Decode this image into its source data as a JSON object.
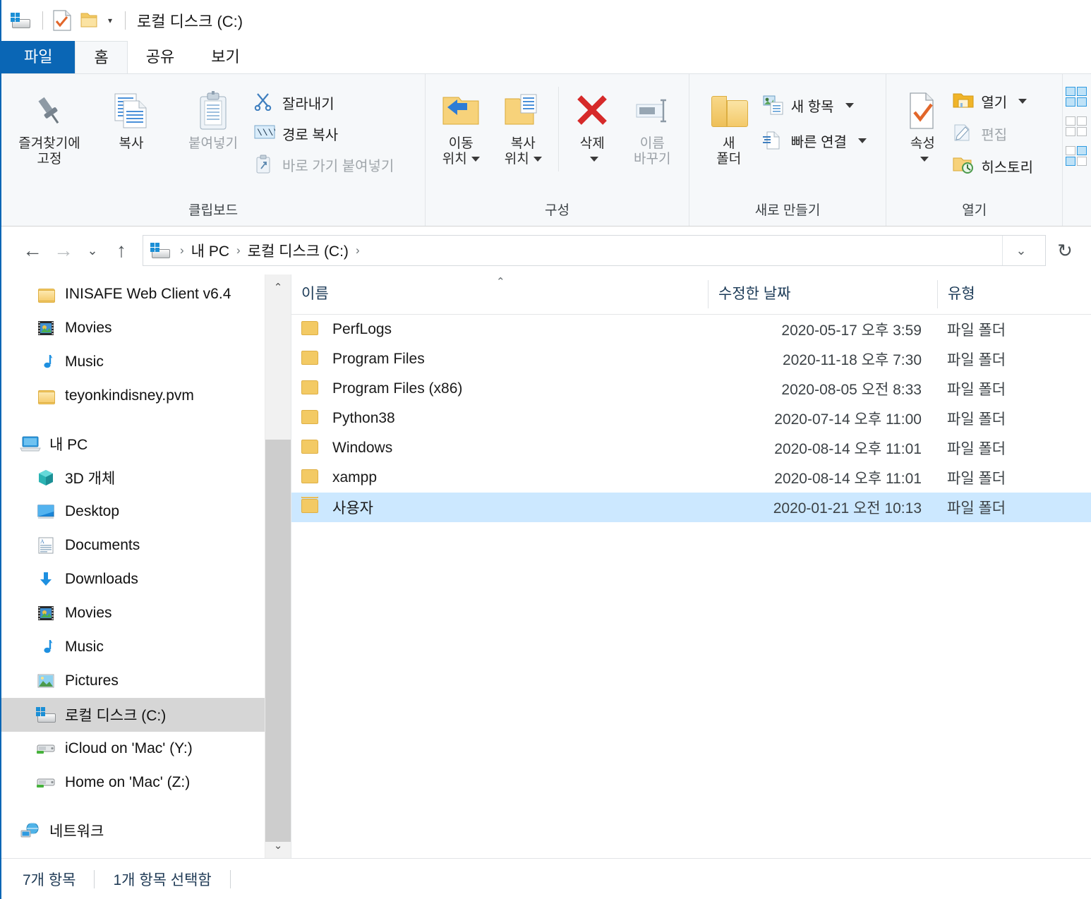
{
  "window": {
    "title": "로컬 디스크 (C:)"
  },
  "quick_access": {
    "icons": [
      "drive-icon",
      "properties-icon",
      "new-folder-icon"
    ],
    "customize_caret": "▾"
  },
  "tabs": [
    {
      "label": "파일",
      "name": "tab-file",
      "active": false,
      "style": "file"
    },
    {
      "label": "홈",
      "name": "tab-home",
      "active": true,
      "style": "normal"
    },
    {
      "label": "공유",
      "name": "tab-share",
      "active": false,
      "style": "normal"
    },
    {
      "label": "보기",
      "name": "tab-view",
      "active": false,
      "style": "normal"
    }
  ],
  "ribbon": {
    "groups": [
      {
        "label": "클립보드",
        "name": "ribbon-group-clipboard",
        "big": [
          {
            "label": "즐겨찾기에\n고정",
            "name": "pin-to-quick-access-button",
            "icon": "pin-icon"
          },
          {
            "label": "복사",
            "name": "copy-button",
            "icon": "copy-icon"
          },
          {
            "label": "붙여넣기",
            "name": "paste-button",
            "icon": "paste-icon",
            "dim": true
          }
        ],
        "small": [
          {
            "label": "잘라내기",
            "name": "cut-button",
            "icon": "scissors-icon",
            "dim": false
          },
          {
            "label": "경로 복사",
            "name": "copy-path-button",
            "icon": "copy-path-icon",
            "dim": false
          },
          {
            "label": "바로 가기 붙여넣기",
            "name": "paste-shortcut-button",
            "icon": "paste-shortcut-icon",
            "dim": true
          }
        ]
      },
      {
        "label": "구성",
        "name": "ribbon-group-organize",
        "big": [
          {
            "label": "이동\n위치",
            "name": "move-to-button",
            "icon": "move-to-icon",
            "caret": true
          },
          {
            "label": "복사\n위치",
            "name": "copy-to-button",
            "icon": "copy-to-icon",
            "caret": true
          },
          {
            "label": "삭제",
            "name": "delete-button",
            "icon": "delete-icon",
            "caret": true
          },
          {
            "label": "이름\n바꾸기",
            "name": "rename-button",
            "icon": "rename-icon",
            "dim": true
          }
        ]
      },
      {
        "label": "새로 만들기",
        "name": "ribbon-group-new",
        "big": [
          {
            "label": "새\n폴더",
            "name": "new-folder-button",
            "icon": "new-folder-icon"
          }
        ],
        "small": [
          {
            "label": "새 항목",
            "name": "new-item-button",
            "icon": "new-item-icon",
            "caret": true
          },
          {
            "label": "빠른 연결",
            "name": "easy-access-button",
            "icon": "easy-access-icon",
            "caret": true
          }
        ]
      },
      {
        "label": "열기",
        "name": "ribbon-group-open",
        "big": [
          {
            "label": "속성",
            "name": "properties-button",
            "icon": "properties-icon",
            "caret": true
          }
        ],
        "small": [
          {
            "label": "열기",
            "name": "open-button",
            "icon": "open-folder-icon",
            "caret": true,
            "dim": false
          },
          {
            "label": "편집",
            "name": "edit-button",
            "icon": "edit-icon",
            "dim": true
          },
          {
            "label": "히스토리",
            "name": "history-button",
            "icon": "history-icon",
            "dim": false
          }
        ]
      },
      {
        "label": "",
        "name": "ribbon-group-select",
        "select_icons": [
          "select-all-icon",
          "select-none-icon",
          "invert-selection-icon"
        ]
      }
    ]
  },
  "addressbar": {
    "back": "←",
    "forward": "→",
    "recent": "⌄",
    "up": "↑",
    "crumbs": [
      "내 PC",
      "로컬 디스크 (C:)"
    ],
    "separator": "›",
    "dropdown": "⌄",
    "refresh": "↻"
  },
  "navigation": {
    "items": [
      {
        "label": "INISAFE Web Client v6.4",
        "icon": "folder-icon",
        "level": "child",
        "selected": false
      },
      {
        "label": "Movies",
        "icon": "movies-icon",
        "level": "child",
        "selected": false
      },
      {
        "label": "Music",
        "icon": "music-icon",
        "level": "child",
        "selected": false
      },
      {
        "label": "teyonkindisney.pvm",
        "icon": "folder-icon",
        "level": "child",
        "selected": false
      },
      {
        "label": "",
        "icon": "gap",
        "level": "gap",
        "selected": false
      },
      {
        "label": "내 PC",
        "icon": "this-pc-icon",
        "level": "root",
        "selected": false
      },
      {
        "label": "3D 개체",
        "icon": "3d-objects-icon",
        "level": "child",
        "selected": false
      },
      {
        "label": "Desktop",
        "icon": "desktop-icon",
        "level": "child",
        "selected": false
      },
      {
        "label": "Documents",
        "icon": "documents-icon",
        "level": "child",
        "selected": false
      },
      {
        "label": "Downloads",
        "icon": "downloads-icon",
        "level": "child",
        "selected": false
      },
      {
        "label": "Movies",
        "icon": "movies-icon",
        "level": "child",
        "selected": false
      },
      {
        "label": "Music",
        "icon": "music-icon",
        "level": "child",
        "selected": false
      },
      {
        "label": "Pictures",
        "icon": "pictures-icon",
        "level": "child",
        "selected": false
      },
      {
        "label": "로컬 디스크 (C:)",
        "icon": "local-disk-icon",
        "level": "child",
        "selected": true
      },
      {
        "label": "iCloud on 'Mac' (Y:)",
        "icon": "network-drive-icon",
        "level": "child",
        "selected": false
      },
      {
        "label": "Home on 'Mac' (Z:)",
        "icon": "network-drive-icon",
        "level": "child",
        "selected": false
      },
      {
        "label": "",
        "icon": "gap",
        "level": "gap",
        "selected": false
      },
      {
        "label": "네트워크",
        "icon": "network-icon",
        "level": "root",
        "selected": false
      }
    ],
    "scroll": {
      "up_arrow": "⌃",
      "down_arrow": "⌄"
    }
  },
  "filelist": {
    "columns": [
      {
        "label": "이름",
        "name": "column-header-name",
        "sorted": true
      },
      {
        "label": "수정한 날짜",
        "name": "column-header-date-modified",
        "sorted": false
      },
      {
        "label": "유형",
        "name": "column-header-type",
        "sorted": false
      }
    ],
    "sort_indicator": "⌃",
    "rows": [
      {
        "name": "PerfLogs",
        "date": "2020-05-17 오후 3:59",
        "type": "파일 폴더",
        "selected": false
      },
      {
        "name": "Program Files",
        "date": "2020-11-18 오후 7:30",
        "type": "파일 폴더",
        "selected": false
      },
      {
        "name": "Program Files (x86)",
        "date": "2020-08-05 오전 8:33",
        "type": "파일 폴더",
        "selected": false
      },
      {
        "name": "Python38",
        "date": "2020-07-14 오후 11:00",
        "type": "파일 폴더",
        "selected": false
      },
      {
        "name": "Windows",
        "date": "2020-08-14 오후 11:01",
        "type": "파일 폴더",
        "selected": false
      },
      {
        "name": "xampp",
        "date": "2020-08-14 오후 11:01",
        "type": "파일 폴더",
        "selected": false
      },
      {
        "name": "사용자",
        "date": "2020-01-21 오전 10:13",
        "type": "파일 폴더",
        "selected": true
      }
    ]
  },
  "statusbar": {
    "item_count": "7개 항목",
    "selection": "1개 항목 선택함"
  },
  "colors": {
    "accent": "#0a66b5",
    "selection_row": "#cce8ff",
    "selection_nav": "#d6d6d6",
    "ribbon_bg": "#f6f8fa",
    "header_text": "#1b3a57"
  }
}
